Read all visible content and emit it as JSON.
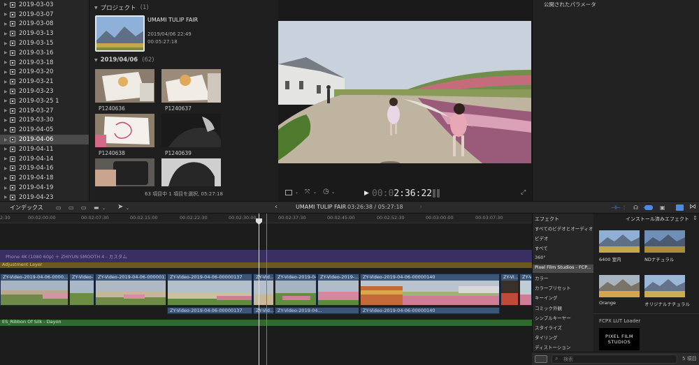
{
  "sidebar": {
    "items": [
      {
        "label": "2019-03-03"
      },
      {
        "label": "2019-03-07"
      },
      {
        "label": "2019-03-08"
      },
      {
        "label": "2019-03-13"
      },
      {
        "label": "2019-03-15"
      },
      {
        "label": "2019-03-16"
      },
      {
        "label": "2019-03-18"
      },
      {
        "label": "2019-03-20"
      },
      {
        "label": "2019-03-21"
      },
      {
        "label": "2019-03-23"
      },
      {
        "label": "2019-03-25 1"
      },
      {
        "label": "2019-03-27"
      },
      {
        "label": "2019-03-30"
      },
      {
        "label": "2019-04-05"
      },
      {
        "label": "2019-04-06"
      },
      {
        "label": "2019-04-11"
      },
      {
        "label": "2019-04-14"
      },
      {
        "label": "2019-04-16"
      },
      {
        "label": "2019-04-18"
      },
      {
        "label": "2019-04-19"
      },
      {
        "label": "2019-04-23"
      }
    ],
    "selected_index": 14
  },
  "browser": {
    "project_header": "プロジェクト",
    "project_count": "(1)",
    "project": {
      "name": "UMAMI TULIP FAIR",
      "date": "2019/04/06 22:49",
      "duration": "00:05:27:18"
    },
    "date_header": "2019/04/06",
    "date_count": "(62)",
    "clips": [
      {
        "label": "P1240636"
      },
      {
        "label": "P1240637"
      },
      {
        "label": "P1240638"
      },
      {
        "label": "P1240639"
      }
    ],
    "footer": "63 項目中 1 項目を選択, 05:27:18"
  },
  "viewer": {
    "timecode_dim": "00:0",
    "timecode": "2:36:22"
  },
  "inspector": {
    "title": "公開されたパラメータ"
  },
  "timeline_bar": {
    "index_label": "インデックス",
    "project_title": "UMAMI TULIP FAIR",
    "duration": "03:26:38 / 05:27:18"
  },
  "timeline": {
    "ruler": [
      "2:30",
      "00:02:00:00",
      "00:02:07:30",
      "00:02:15:00",
      "00:02:22:30",
      "00:02:30:00",
      "00:02:37:30",
      "00:02:45:00",
      "00:02:52:30",
      "00:03:00:00",
      "00:03:07:30"
    ],
    "compound_label": "Phone 4K (1080 60p) ＋ ZHIYUN SMOOTH 4 - カスタム",
    "adjustment_label": "Adjustment Layer",
    "clips": [
      {
        "label": "ZY-Video-2019-04-06-0000..."
      },
      {
        "label": "ZY-Video-..."
      },
      {
        "label": "ZY-Video-2019-04-06-00000136"
      },
      {
        "label": "ZY-Video-2019-04-06-00000137"
      },
      {
        "label": "ZY-Vid..."
      },
      {
        "label": "ZY-Video-2019-04..."
      },
      {
        "label": "ZY-Video-2019-..."
      },
      {
        "label": "ZY-Video-2019-04-06-00000140"
      },
      {
        "label": "ZY-Vi..."
      },
      {
        "label": "ZY-Vid..."
      }
    ],
    "connected": [
      {
        "label": "ZY-Video-2019-04-06-00000137"
      },
      {
        "label": "ZY-Vid..."
      },
      {
        "label": "ZY-Video-2019-04..."
      },
      {
        "label": "ZY-Video-2019-04-06-00000140"
      }
    ],
    "audio_label": "ES_Ribbon Of Silk - Dayon"
  },
  "effects": {
    "header": "エフェクト",
    "categories": [
      {
        "label": "すべてのビデオとオーディオ"
      },
      {
        "label": "ビデオ"
      },
      {
        "label": "すべて"
      },
      {
        "label": "360°"
      },
      {
        "label": "Pixel Film Studios - FCP..."
      },
      {
        "label": "カラー"
      },
      {
        "label": "カラープリセット"
      },
      {
        "label": "キーイング"
      },
      {
        "label": "コミック外観"
      },
      {
        "label": "シンプルキーヤー"
      },
      {
        "label": "スタイライズ"
      },
      {
        "label": "タイリング"
      },
      {
        "label": "ディストーション"
      }
    ],
    "selected_index": 4,
    "installed_label": "インストール済みエフェクト",
    "items": [
      {
        "label": "6400 室内"
      },
      {
        "label": "NDナチュラル"
      },
      {
        "label": "Orange"
      },
      {
        "label": "オリジナルナチュラル"
      }
    ],
    "loader_label": "FCPX LUT Loader",
    "pfs_line1": "PIXEL FILM",
    "pfs_line2": "STUDIOS",
    "search_placeholder": "検索",
    "count": "5 項目"
  }
}
